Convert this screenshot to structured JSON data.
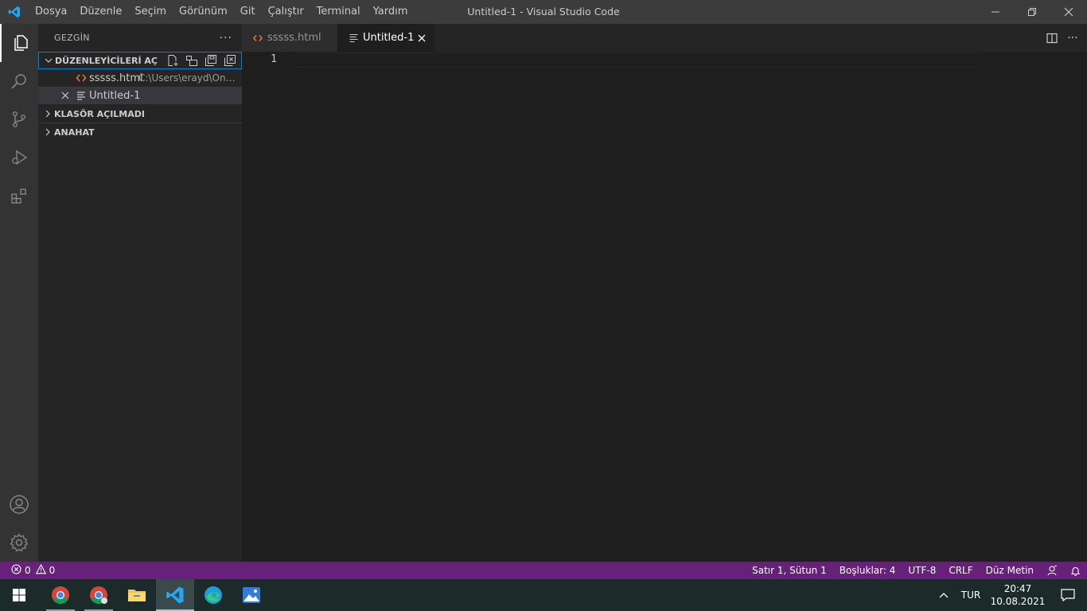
{
  "window": {
    "title": "Untitled-1 - Visual Studio Code"
  },
  "menu": {
    "items": [
      "Dosya",
      "Düzenle",
      "Seçim",
      "Görünüm",
      "Git",
      "Çalıştır",
      "Terminal",
      "Yardım"
    ]
  },
  "sidebar": {
    "title": "GEZGİN",
    "open_editors": {
      "label": "DÜZENLEYİCİLERİ AÇ",
      "files": [
        {
          "name": "sssss.html",
          "path": "C:\\Users\\erayd\\OneDri..."
        },
        {
          "name": "Untitled-1"
        }
      ]
    },
    "no_folder_label": "KLASÖR AÇILMADI",
    "outline_label": "ANAHAT"
  },
  "tabs": [
    {
      "label": "sssss.html",
      "active": false
    },
    {
      "label": "Untitled-1",
      "active": true
    }
  ],
  "editor": {
    "line_numbers": [
      "1"
    ]
  },
  "statusbar": {
    "errors": "0",
    "warnings": "0",
    "position": "Satır 1, Sütun 1",
    "spaces": "Boşluklar: 4",
    "encoding": "UTF-8",
    "eol": "CRLF",
    "language": "Düz Metin"
  },
  "taskbar": {
    "language": "TUR",
    "time": "20:47",
    "date": "10.08.2021"
  },
  "colors": {
    "accent": "#68217a",
    "vscode_blue": "#23a9f2",
    "html_icon": "#e37933"
  }
}
